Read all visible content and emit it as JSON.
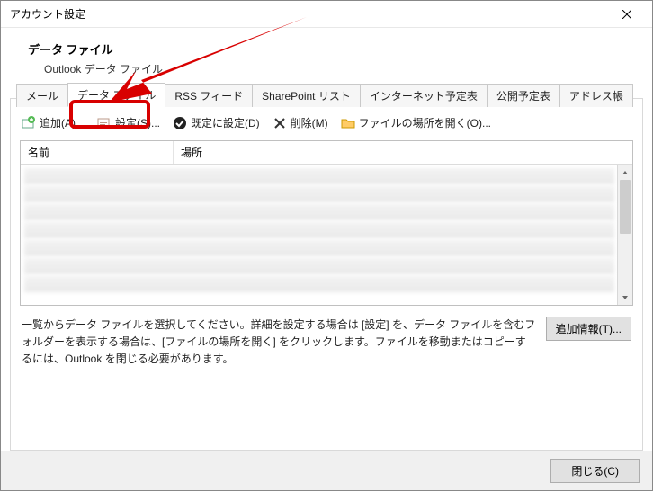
{
  "window": {
    "title": "アカウント設定"
  },
  "header": {
    "title": "データ ファイル",
    "subtitle": "Outlook データ ファイル"
  },
  "tabs": [
    {
      "label": "メール"
    },
    {
      "label": "データ ファイル"
    },
    {
      "label": "RSS フィード"
    },
    {
      "label": "SharePoint リスト"
    },
    {
      "label": "インターネット予定表"
    },
    {
      "label": "公開予定表"
    },
    {
      "label": "アドレス帳"
    }
  ],
  "toolbar": {
    "add": "追加(A)...",
    "settings": "設定(S)...",
    "default": "既定に設定(D)",
    "remove": "削除(M)",
    "open_location": "ファイルの場所を開く(O)..."
  },
  "columns": {
    "name": "名前",
    "location": "場所"
  },
  "help": "一覧からデータ ファイルを選択してください。詳細を設定する場合は [設定] を、データ ファイルを含むフォルダーを表示する場合は、[ファイルの場所を開く] をクリックします。ファイルを移動またはコピーするには、Outlook を閉じる必要があります。",
  "more_info_btn": "追加情報(T)...",
  "close_btn": "閉じる(C)"
}
